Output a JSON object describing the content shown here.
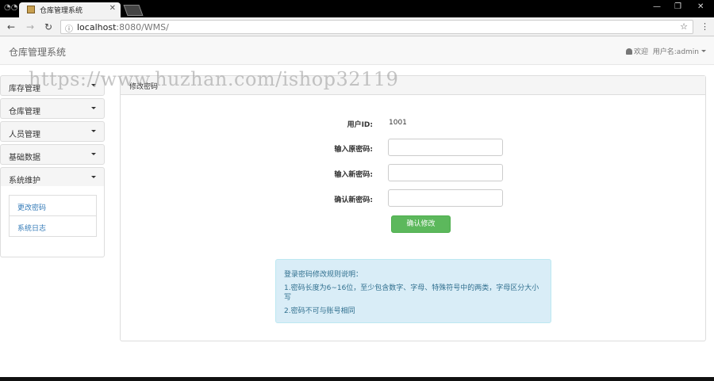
{
  "browser": {
    "tab_title": "仓库管理系统",
    "tab_close": "✕",
    "url_host": "localhost",
    "url_rest": ":8080/WMS/",
    "window_controls": [
      "—",
      "❐",
      "✕"
    ]
  },
  "navbar": {
    "brand": "仓库管理系统",
    "welcome": "欢迎",
    "username_label": "用户名:admin"
  },
  "sidebar": {
    "items": [
      {
        "label": "库存管理"
      },
      {
        "label": "仓库管理"
      },
      {
        "label": "人员管理"
      },
      {
        "label": "基础数据"
      },
      {
        "label": "系统维护"
      }
    ],
    "sub_items": [
      {
        "label": "更改密码"
      },
      {
        "label": "系统日志"
      }
    ]
  },
  "main": {
    "panel_title": "修改密码",
    "user_id_label": "用户ID:",
    "user_id_value": "1001",
    "old_password_label": "输入原密码:",
    "new_password_label": "输入新密码:",
    "confirm_password_label": "确认新密码:",
    "submit_label": "确认修改",
    "rules": {
      "title": "登录密码修改规则说明：",
      "rule1_line1": "1.密码长度为6~16位，至少包含数字、字母、特殊符号中的两类，字母区分大小",
      "rule1_line2": "写",
      "rule2": "2.密码不可与账号相同"
    }
  },
  "watermark": "https://www.huzhan.com/ishop32119"
}
